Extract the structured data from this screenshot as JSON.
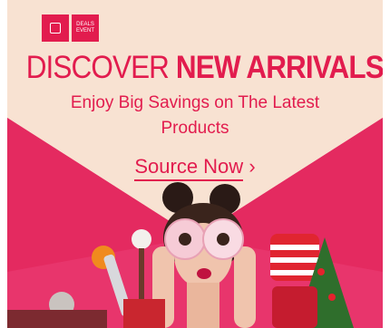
{
  "brand": {
    "logo_left": "",
    "logo_right": "DEALS EVENT",
    "accent": "#e21c4e",
    "background": "#e8356c"
  },
  "headline": {
    "part1": "DISCOVER ",
    "part2": "NEW ARRIVALS"
  },
  "subline": {
    "line1": "Enjoy Big Savings on The Latest",
    "line2": "Products"
  },
  "cta": {
    "label": "Source Now",
    "arrow": "›"
  }
}
